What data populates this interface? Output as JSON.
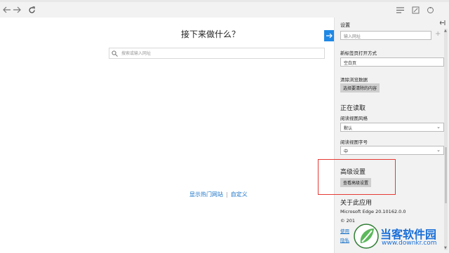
{
  "toolbar": {
    "back_icon": "back-arrow-icon",
    "forward_icon": "forward-arrow-icon",
    "refresh_icon": "refresh-icon",
    "hub_icon": "hub-menu-icon",
    "note_icon": "web-note-icon",
    "share_icon": "share-icon"
  },
  "newtab": {
    "heading": "接下来做什么？",
    "search_placeholder": "搜索或输入网址",
    "link_hot_sites": "显示热门网站",
    "separator": "|",
    "link_customize": "自定义"
  },
  "settings": {
    "title": "设置",
    "url_input_placeholder": "输入网址",
    "plus": "+",
    "new_tab_label": "新标签页打开方式",
    "new_tab_value": "空白页",
    "clear_data_label": "清除浏览数据",
    "clear_data_button": "选择要清除的内容",
    "reading_section": "正在读取",
    "reading_style_label": "阅读视图风格",
    "reading_style_value": "默认",
    "reading_font_label": "阅读视图字号",
    "reading_font_value": "中",
    "advanced_section": "高级设置",
    "advanced_button": "查看高级设置",
    "about_section": "关于此应用",
    "version": "Microsoft Edge 20.10162.0.0",
    "copyright": "© 201",
    "link_terms": "使用",
    "link_privacy": "隐私"
  },
  "watermark": {
    "name": "当客软件园",
    "url": "www.downkr.com"
  },
  "colors": {
    "accent": "#1e88e5",
    "highlight_border": "#e53935",
    "link": "#1a73c7",
    "panel_bg": "#f2f2f2"
  }
}
